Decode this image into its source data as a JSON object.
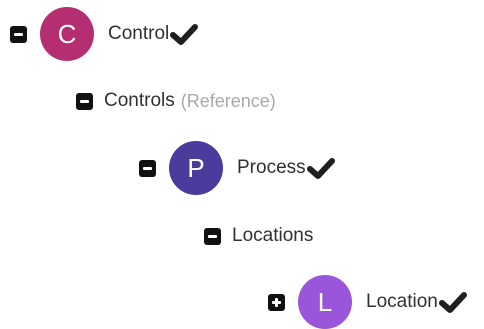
{
  "tree": {
    "control": {
      "avatar_letter": "C",
      "avatar_color": "#b52e72",
      "label": "Control",
      "status_icon": "checkmark-icon"
    },
    "controls_reference": {
      "label": "Controls",
      "qualifier": "(Reference)"
    },
    "process": {
      "avatar_letter": "P",
      "avatar_color": "#4a3c9c",
      "label": "Process",
      "status_icon": "checkmark-icon"
    },
    "locations": {
      "label": "Locations"
    },
    "location": {
      "avatar_letter": "L",
      "avatar_color": "#9a55da",
      "label": "Location",
      "status_icon": "checkmark-icon"
    }
  },
  "icons": {
    "collapse": "minus-square-icon",
    "expand": "plus-square-icon"
  }
}
